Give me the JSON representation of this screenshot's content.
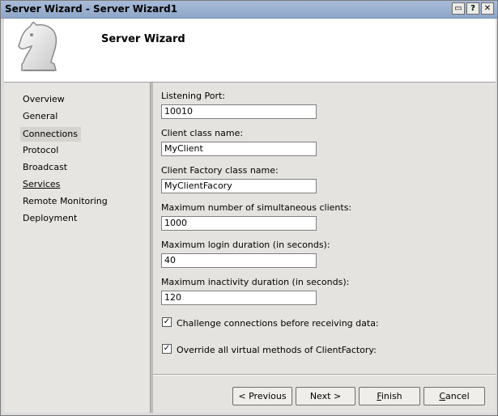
{
  "window": {
    "title": "Server Wizard - Server Wizard1",
    "controls": [
      "▭",
      "?",
      "✕"
    ]
  },
  "header": {
    "title": "Server Wizard",
    "logo_icon": "chess-knight-icon"
  },
  "sidebar": {
    "items": [
      {
        "label": "Overview"
      },
      {
        "label": "General"
      },
      {
        "label": "Connections"
      },
      {
        "label": "Protocol"
      },
      {
        "label": "Broadcast"
      },
      {
        "label": "Services"
      },
      {
        "label": "Remote Monitoring"
      },
      {
        "label": "Deployment"
      }
    ],
    "selected": "Connections"
  },
  "form": {
    "listening_port": {
      "label": "Listening Port:",
      "value": "10010"
    },
    "client_class": {
      "label": "Client class name:",
      "value": "MyClient"
    },
    "client_factory_class": {
      "label": "Client Factory class name:",
      "value": "MyClientFacory"
    },
    "max_clients": {
      "label": "Maximum number of simultaneous clients:",
      "value": "1000"
    },
    "max_login_duration": {
      "label": "Maximum login duration (in seconds):",
      "value": "40"
    },
    "max_inactivity": {
      "label": "Maximum inactivity duration (in seconds):",
      "value": "120"
    },
    "challenge": {
      "label": "Challenge connections before receiving data:",
      "checked": "✓"
    },
    "override": {
      "label": "Override all virtual methods of ClientFactory:",
      "checked": "✓"
    }
  },
  "buttons": {
    "previous": "< Previous",
    "next": "Next >",
    "finish_mnemonic": "F",
    "finish_rest": "inish",
    "cancel_mnemonic": "C",
    "cancel_rest": "ancel"
  }
}
